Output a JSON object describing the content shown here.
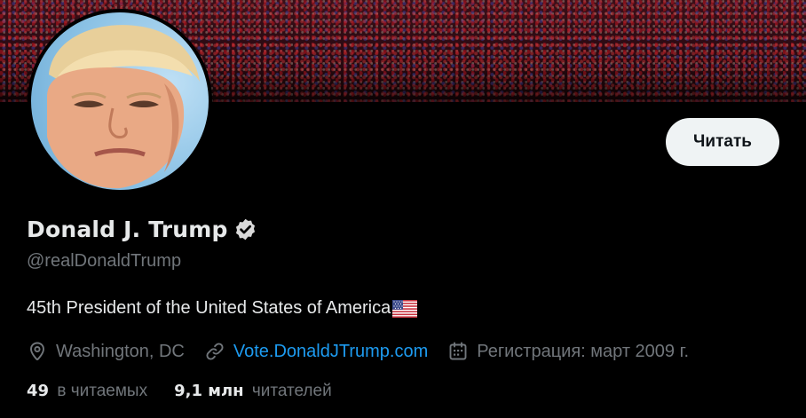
{
  "profile": {
    "name": "Donald J. Trump",
    "handle": "@realDonaldTrump",
    "bio": "45th President of the United States of America",
    "location": "Washington, DC",
    "website": "Vote.DonaldJTrump.com",
    "joined": "Регистрация: март 2009 г.",
    "following_count": "49",
    "following_label": "в читаемых",
    "followers_count": "9,1 млн",
    "followers_label": "читателей"
  },
  "actions": {
    "follow_label": "Читать"
  },
  "icons": {
    "verified": "verified-badge-icon",
    "location": "location-pin-icon",
    "website": "link-icon",
    "joined": "calendar-icon",
    "bio_emoji": "us-flag-icon"
  },
  "colors": {
    "background": "#000000",
    "primary_text": "#e7e9ea",
    "secondary_text": "#71767b",
    "link": "#1d9bf0",
    "button_bg": "#eff3f4"
  }
}
